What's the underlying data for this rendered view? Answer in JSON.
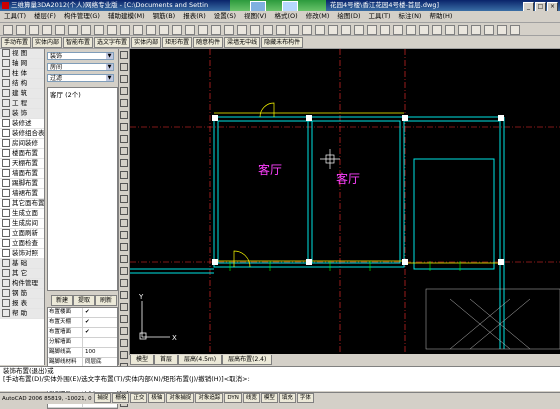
{
  "window": {
    "title": "三维算量3DA2012(个人)网络专业版 - [C:\\Documents and Settin",
    "title_tail": "花园4号楼\\香江花园4号楼-首层.dwg]"
  },
  "menubar": [
    "工具(T)",
    "楼层(F)",
    "构件管理(G)",
    "辅助建模(M)",
    "钢筋(B)",
    "报表(R)",
    "设置(S)",
    "视图(V)",
    "格式(O)",
    "修改(M)",
    "绘图(D)",
    "工具(T)",
    "标注(N)",
    "帮助(H)"
  ],
  "toolbar2": [
    "手动布置",
    "实体内部",
    "智能布置",
    "选文字布置",
    "实体内部",
    "矩形布置",
    "随意构件",
    "梁墙无中线",
    "隐藏未布构件"
  ],
  "leftnav": {
    "items": [
      {
        "label": "视 图",
        "type": "cat"
      },
      {
        "label": "轴 网",
        "type": "cat"
      },
      {
        "label": "柱 体",
        "type": "cat"
      },
      {
        "label": "结 构",
        "type": "cat"
      },
      {
        "label": "建 筑",
        "type": "cat"
      },
      {
        "label": "工 程",
        "type": "cat"
      },
      {
        "label": "装 饰",
        "type": "cat"
      },
      {
        "label": "装修述",
        "type": "item"
      },
      {
        "label": "装修组合表",
        "type": "item"
      },
      {
        "label": "房间装修",
        "type": "item"
      },
      {
        "label": "楼面布置",
        "type": "item"
      },
      {
        "label": "天棚布置",
        "type": "item"
      },
      {
        "label": "墙面布置",
        "type": "item"
      },
      {
        "label": "踢脚布置",
        "type": "item"
      },
      {
        "label": "墙裙布置",
        "type": "item"
      },
      {
        "label": "其它面布置",
        "type": "item"
      },
      {
        "label": "生成立面",
        "type": "item"
      },
      {
        "label": "生成房间",
        "type": "item"
      },
      {
        "label": "立面刷新",
        "type": "item"
      },
      {
        "label": "立面检查",
        "type": "item"
      },
      {
        "label": "装饰对照",
        "type": "item"
      },
      {
        "label": "基 础",
        "type": "cat"
      },
      {
        "label": "其 它",
        "type": "cat"
      },
      {
        "label": "构件管理",
        "type": "cat"
      },
      {
        "label": "钢 筋",
        "type": "cat"
      },
      {
        "label": "报 表",
        "type": "cat"
      },
      {
        "label": "帮 助",
        "type": "cat"
      }
    ]
  },
  "midpanel": {
    "select1": "装饰",
    "select2": "房间",
    "select3": "过滤",
    "list_header": "客厅 (2个)",
    "buttons": [
      "新建",
      "提取",
      "刷新"
    ],
    "props": [
      {
        "k": "布置楼面",
        "v": "check"
      },
      {
        "k": "布置天棚",
        "v": "check"
      },
      {
        "k": "布置墙面",
        "v": "check"
      },
      {
        "k": "分解墙面",
        "v": ""
      },
      {
        "k": "踢脚线高",
        "v": "100"
      },
      {
        "k": "踢脚线材料",
        "v": "同层底"
      },
      {
        "k": "墙面装饰高",
        "v": "同层底"
      },
      {
        "k": "墙面装饰材料",
        "v": "同层底"
      },
      {
        "k": "墙面高度",
        "v": "(无)"
      },
      {
        "k": "天棚标高",
        "v": "同层底"
      }
    ]
  },
  "canvas": {
    "room_labels": [
      "客厅",
      "客厅"
    ],
    "ucs_x": "X",
    "ucs_y": "Y"
  },
  "tabs": [
    "模型",
    "首层",
    "层高(4.5m)",
    "层高布置(2.4)"
  ],
  "cmdline": {
    "line1": "装饰布置(退出)或",
    "line2": "[手动布置(D)/实体外围(E)/选文字布置(T)/实体内部(N)/矩形布置(J)/撤销(H)]<取消>:"
  },
  "statusbar": {
    "coords": "AutoCAD 2006  85819, -10021, 0",
    "buttons": [
      "捕捉",
      "栅格",
      "正交",
      "极轴",
      "对象捕捉",
      "对象追踪",
      "DYN",
      "线宽",
      "模型",
      "填充",
      "字体"
    ]
  },
  "colors": {
    "wall": "#00e5e5",
    "grid": "#ff3030",
    "beam": "#ffff00",
    "room_text": "#ff40ff",
    "door": "#ffff00"
  }
}
